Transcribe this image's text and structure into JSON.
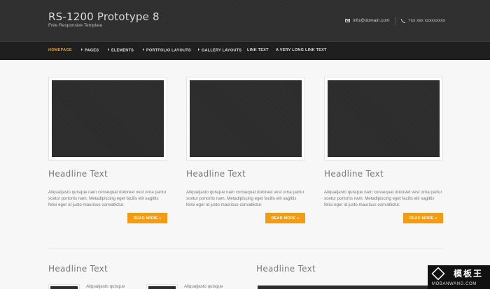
{
  "header": {
    "title": "RS-1200 Prototype 8",
    "tagline": "Free Responsive Template",
    "email": "info@domain.com",
    "phone": "+xx xxx xxxxxxxxx",
    "email_icon": "envelope-icon",
    "phone_icon": "phone-icon"
  },
  "nav": {
    "items": [
      {
        "label": "HOMEPAGE",
        "active": true,
        "dropdown": false
      },
      {
        "label": "PAGES",
        "active": false,
        "dropdown": true
      },
      {
        "label": "ELEMENTS",
        "active": false,
        "dropdown": true
      },
      {
        "label": "PORTFOLIO LAYOUTS",
        "active": false,
        "dropdown": true
      },
      {
        "label": "GALLERY LAYOUTS",
        "active": false,
        "dropdown": true
      },
      {
        "label": "LINK TEXT",
        "active": false,
        "dropdown": false
      },
      {
        "label": "A VERY LONG LINK TEXT",
        "active": false,
        "dropdown": false
      }
    ],
    "active_color": "#f39c12"
  },
  "cards": [
    {
      "title": "Headline Text",
      "text": "Aliquatjasto quisque nam consequat doloreet vest orna partur scetur portortis nam. Metadipiscing eget facilis elit sagittis felisi eger id justo maurisus convallictur.",
      "button": "READ MORE »"
    },
    {
      "title": "Headline Text",
      "text": "Aliquatjasto quisque nam consequat doloreet vest orna partur scetur portortis nam. Metadipiscing eget facilis elit sagittis felisi eger id justo maurisus convallictur.",
      "button": "READ MORE »"
    },
    {
      "title": "Headline Text",
      "text": "Aliquatjasto quisque nam consequat doloreet vest orna partur scetur portortis nam. Metadipiscing eget facilis elit sagittis felisi eger id justo maurisus convallictur.",
      "button": "READ MORE »"
    }
  ],
  "sections": [
    {
      "title": "Headline Text",
      "items": [
        "Aliquatjasto quisque",
        "Aliquatjasto quisque"
      ]
    },
    {
      "title": "Headline Text"
    }
  ],
  "watermark": {
    "cn": "模板王",
    "en": "MOBANWANG.COM"
  },
  "colors": {
    "accent": "#f39c12",
    "header_bg": "#2e2e2e",
    "nav_bg": "#1f1f1f"
  }
}
